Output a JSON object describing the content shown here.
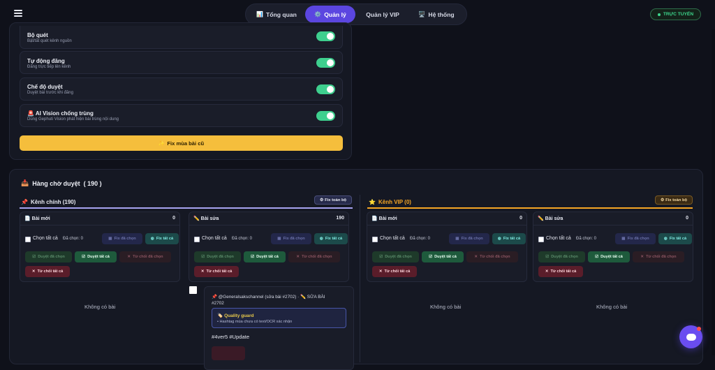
{
  "nav": {
    "tabs": [
      {
        "label": "Tổng quan",
        "icon": "📊"
      },
      {
        "label": "Quản lý",
        "icon": "⚙️"
      },
      {
        "label": "Quản lý VIP",
        "icon": ""
      },
      {
        "label": "Hệ thống",
        "icon": "🖥️"
      }
    ],
    "active_tab": 1
  },
  "status": {
    "label": "TRỰC TUYẾN",
    "color": "#3dd68c"
  },
  "settings": [
    {
      "title": "Bộ quét",
      "desc": "Bật/tắt quét kênh nguồn",
      "on": true
    },
    {
      "title": "Tự động đăng",
      "desc": "Đăng trực tiếp lên kênh",
      "on": true
    },
    {
      "title": "Chế độ duyệt",
      "desc": "Duyệt bài trước khi đăng",
      "on": true
    },
    {
      "title": "AI Vision chống trùng",
      "icon": "🚨",
      "desc": "Dùng Gephuti Vision phát hiện bài trùng nội dung",
      "on": true
    }
  ],
  "fix_old_button": {
    "label": "Fix mùa bài cũ",
    "icon": "✨"
  },
  "queue": {
    "title": "Hàng chờ duyệt",
    "count": "( 190 )",
    "icon": "📥",
    "columns": [
      {
        "name": "Kênh chính (190)",
        "icon": "📌",
        "fix_all": "Fix toàn bộ",
        "accent": "#a7a3f0",
        "subpanels": [
          {
            "label": "Bài mới",
            "icon": "📄",
            "count": "0",
            "empty": "Không có bài"
          },
          {
            "label": "Bài sửa",
            "icon": "✏️",
            "count": "190",
            "empty": ""
          }
        ]
      },
      {
        "name": "Kênh VIP (0)",
        "icon": "⭐",
        "fix_all": "Fix toàn bộ",
        "accent": "#f5a524",
        "subpanels": [
          {
            "label": "Bài mới",
            "icon": "📄",
            "count": "0",
            "empty": "Không có bài"
          },
          {
            "label": "Bài sửa",
            "icon": "✏️",
            "count": "0",
            "empty": "Không có bài"
          }
        ]
      }
    ],
    "controls": {
      "select_all": "Chọn tất cả",
      "selected": "Đã chọn: 0",
      "fix_selected": "Fix đã chọn",
      "fix_all": "Fix tất cả",
      "approve_selected": "Duyệt đã chọn",
      "approve_all": "Duyệt tất cả",
      "reject_selected": "Từ chối đã chọn",
      "reject_all": "Từ chối tất cả"
    },
    "post": {
      "header_line1": "📌 @Generalsakschannel (sửa bài #2702) · ✏️ SỬA BÀI",
      "header_line2": "#2702",
      "guard_title": "Quality guard",
      "guard_icon": "🏷️",
      "guard_desc": "• Hashtag mùa chưa có text/OCR xác nhận",
      "hashtags": "#4ver5 #Update"
    }
  }
}
